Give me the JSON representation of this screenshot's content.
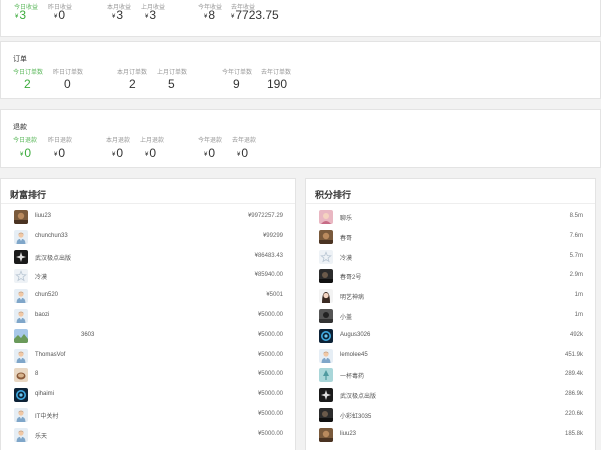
{
  "currency": "¥",
  "top_card": {
    "labels": [
      "今日收益",
      "昨日收益",
      "本月收益",
      "上月收益",
      "今年收益",
      "去年收益"
    ],
    "values": [
      "3",
      "0",
      "3",
      "3",
      "8",
      "7723.75"
    ]
  },
  "orders": {
    "title": "订单",
    "labels": [
      "今日订单数",
      "昨日订单数",
      "本月订单数",
      "上月订单数",
      "今年订单数",
      "去年订单数"
    ],
    "values": [
      "2",
      "0",
      "2",
      "5",
      "9",
      "190"
    ]
  },
  "refunds": {
    "title": "退款",
    "labels": [
      "今日退款",
      "昨日退款",
      "本月退款",
      "上月退款",
      "今年退款",
      "去年退款"
    ],
    "values": [
      "0",
      "0",
      "0",
      "0",
      "0",
      "0"
    ]
  },
  "wealth": {
    "title": "财富排行",
    "rows": [
      {
        "name": "liuu23",
        "value": "¥9972257.29",
        "avatar": "photo-brown"
      },
      {
        "name": "chunchun33",
        "value": "¥99299",
        "avatar": "default-user"
      },
      {
        "name": "武汉极点出版",
        "value": "¥86483.43",
        "avatar": "dark-star"
      },
      {
        "name": "冷漠",
        "value": "¥85940.00",
        "avatar": "star-light"
      },
      {
        "name": "chun520",
        "value": "¥5001",
        "avatar": "default-user"
      },
      {
        "name": "baozi",
        "value": "¥5000.00",
        "avatar": "default-user"
      },
      {
        "name": "3603",
        "value": "¥5000.00",
        "avatar": "landscape"
      },
      {
        "name": "ThomasVof",
        "value": "¥5000.00",
        "avatar": "default-user"
      },
      {
        "name": "8",
        "value": "¥5000.00",
        "avatar": "coffee"
      },
      {
        "name": "qihaimi",
        "value": "¥5000.00",
        "avatar": "blue-circle"
      },
      {
        "name": "IT中关村",
        "value": "¥5000.00",
        "avatar": "default-user"
      },
      {
        "name": "乐天",
        "value": "¥5000.00",
        "avatar": "default-user"
      }
    ]
  },
  "points": {
    "title": "积分排行",
    "rows": [
      {
        "name": "聊乐",
        "value": "8.5m",
        "avatar": "pink-photo"
      },
      {
        "name": "春哥",
        "value": "7.6m",
        "avatar": "photo-brown"
      },
      {
        "name": "冷漠",
        "value": "5.7m",
        "avatar": "star-light"
      },
      {
        "name": "春哥2号",
        "value": "2.9m",
        "avatar": "dark-photo"
      },
      {
        "name": "明艺神病",
        "value": "1m",
        "avatar": "girl-photo"
      },
      {
        "name": "小盖",
        "value": "1m",
        "avatar": "grey-photo"
      },
      {
        "name": "Augus3026",
        "value": "492k",
        "avatar": "blue-circle"
      },
      {
        "name": "lemolee45",
        "value": "451.9k",
        "avatar": "default-user"
      },
      {
        "name": "一杯毒药",
        "value": "289.4k",
        "avatar": "teal-tree"
      },
      {
        "name": "武汉极点出版",
        "value": "286.9k",
        "avatar": "dark-star"
      },
      {
        "name": "小彩虹3035",
        "value": "220.6k",
        "avatar": "dark-photo"
      },
      {
        "name": "liuu23",
        "value": "185.8k",
        "avatar": "photo-brown"
      }
    ]
  }
}
